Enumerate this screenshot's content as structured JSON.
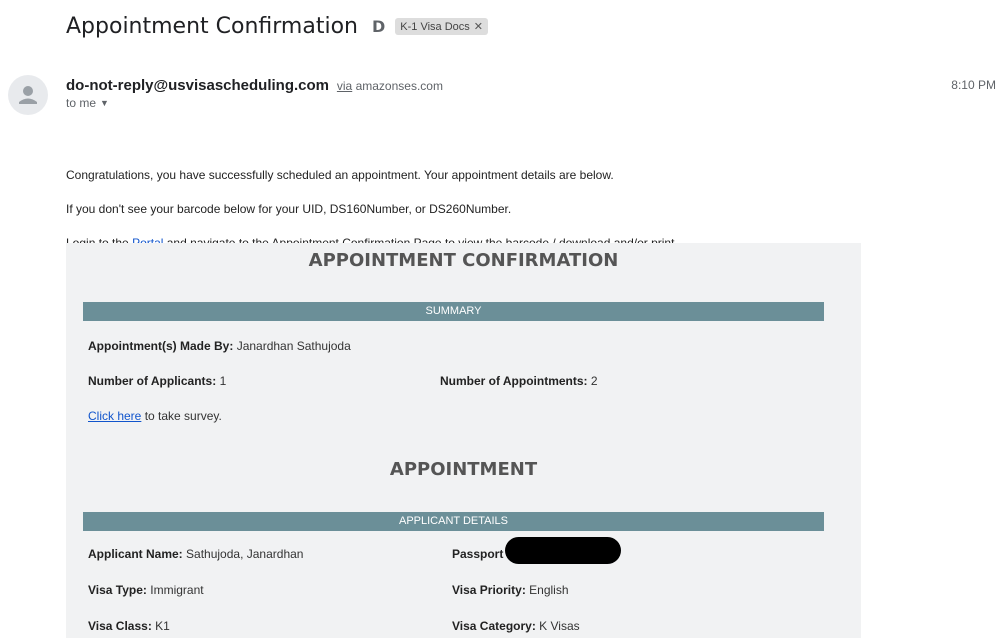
{
  "email": {
    "subject": "Appointment Confirmation",
    "label_chip": "K-1 Visa Docs",
    "sender": "do-not-reply@usvisascheduling.com",
    "via_word": "via",
    "via_domain": "amazonses.com",
    "to": "to me",
    "time": "8:10 PM"
  },
  "body": {
    "line1": "Congratulations, you have successfully scheduled an appointment. Your appointment details are below.",
    "line2": "If you don't see your barcode below for your UID, DS160Number, or DS260Number.",
    "line3_prefix": "Login to the ",
    "line3_link": "Portal",
    "line3_suffix": " and navigate to the Appointment Confirmation Page to view the barcode / download and/or print."
  },
  "card": {
    "title": "APPOINTMENT CONFIRMATION",
    "summary_bar": "SUMMARY",
    "made_by_label": "Appointment(s) Made By:",
    "made_by_value": "Janardhan Sathujoda",
    "num_applicants_label": "Number of Applicants:",
    "num_applicants_value": "1",
    "num_appointments_label": "Number of Appointments:",
    "num_appointments_value": "2",
    "survey_link": "Click here",
    "survey_suffix": " to take survey.",
    "appointment_heading": "APPOINTMENT",
    "applicant_bar": "APPLICANT DETAILS",
    "applicant_name_label": "Applicant Name:",
    "applicant_name_value": "Sathujoda, Janardhan",
    "passport_label": "Passport Numbe",
    "visa_type_label": "Visa Type:",
    "visa_type_value": "Immigrant",
    "visa_priority_label": "Visa Priority:",
    "visa_priority_value": "English",
    "visa_class_label": "Visa Class:",
    "visa_class_value": "K1",
    "visa_category_label": "Visa Category:",
    "visa_category_value": "K Visas"
  }
}
